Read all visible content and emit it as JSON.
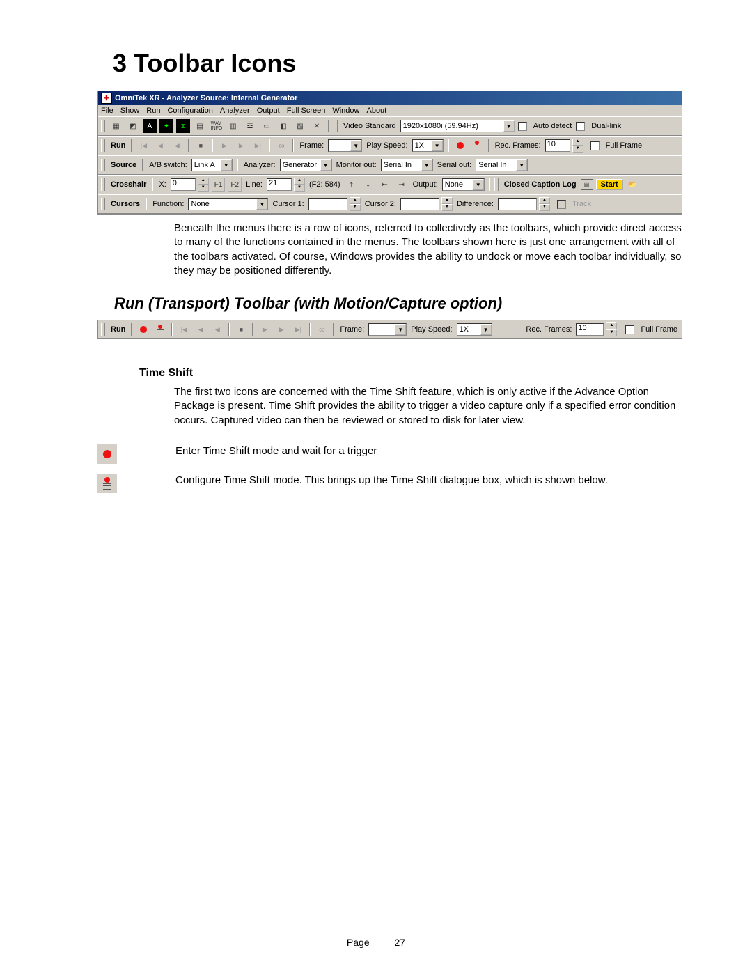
{
  "heading": "3 Toolbar Icons",
  "app": {
    "title": "OmniTek XR - Analyzer Source: Internal Generator",
    "menus": [
      "File",
      "Show",
      "Run",
      "Configuration",
      "Analyzer",
      "Output",
      "Full Screen",
      "Window",
      "About"
    ],
    "video_standard_label": "Video Standard",
    "video_standard_value": "1920x1080i (59.94Hz)",
    "auto_detect": "Auto detect",
    "dual_link": "Dual-link",
    "run": {
      "label": "Run",
      "frame_label": "Frame:",
      "frame_value": "",
      "play_speed_label": "Play Speed:",
      "play_speed_value": "1X",
      "rec_frames_label": "Rec. Frames:",
      "rec_frames_value": "10",
      "full_frame": "Full Frame"
    },
    "source": {
      "label": "Source",
      "ab_switch_label": "A/B switch:",
      "ab_switch_value": "Link A",
      "analyzer_label": "Analyzer:",
      "analyzer_value": "Generator",
      "monitor_out_label": "Monitor out:",
      "monitor_out_value": "Serial In",
      "serial_out_label": "Serial out:",
      "serial_out_value": "Serial In"
    },
    "crosshair": {
      "label": "Crosshair",
      "x_label": "X:",
      "x_value": "0",
      "f1": "F1",
      "f2": "F2",
      "line_label": "Line:",
      "line_value": "21",
      "f2_detail": "(F2: 584)",
      "output_label": "Output:",
      "output_value": "None",
      "cc_label": "Closed Caption Log",
      "start": "Start"
    },
    "cursors": {
      "label": "Cursors",
      "function_label": "Function:",
      "function_value": "None",
      "cursor1": "Cursor 1:",
      "cursor2": "Cursor 2:",
      "difference": "Difference:",
      "track": "Track"
    }
  },
  "para1": "Beneath the menus there is a row of icons, referred to collectively as the toolbars, which provide direct access to many of the functions contained in the menus. The toolbars shown here is just one arrangement with all of the toolbars activated. Of course, Windows provides the ability to undock or move each toolbar individually, so they may be positioned differently.",
  "section_title": "Run (Transport) Toolbar (with Motion/Capture option)",
  "runbar": {
    "label": "Run",
    "frame_label": "Frame:",
    "frame_value": "",
    "play_speed_label": "Play Speed:",
    "play_speed_value": "1X",
    "rec_frames_label": "Rec. Frames:",
    "rec_frames_value": "10",
    "full_frame": "Full Frame"
  },
  "sub_heading": "Time Shift",
  "para2": "The first two icons are concerned with the Time Shift feature, which is only active if the Advance Option Package is present. Time Shift provides the ability to trigger a video capture only if a specified error condition occurs.  Captured video can then be reviewed or stored to disk for later view.",
  "icon1_desc": "Enter Time Shift mode and wait for a trigger",
  "icon2_desc": "Configure Time Shift mode.  This brings up the Time Shift dialogue box, which is shown below.",
  "footer": {
    "label": "Page",
    "num": "27"
  },
  "glyph": {
    "plus": "✚"
  }
}
